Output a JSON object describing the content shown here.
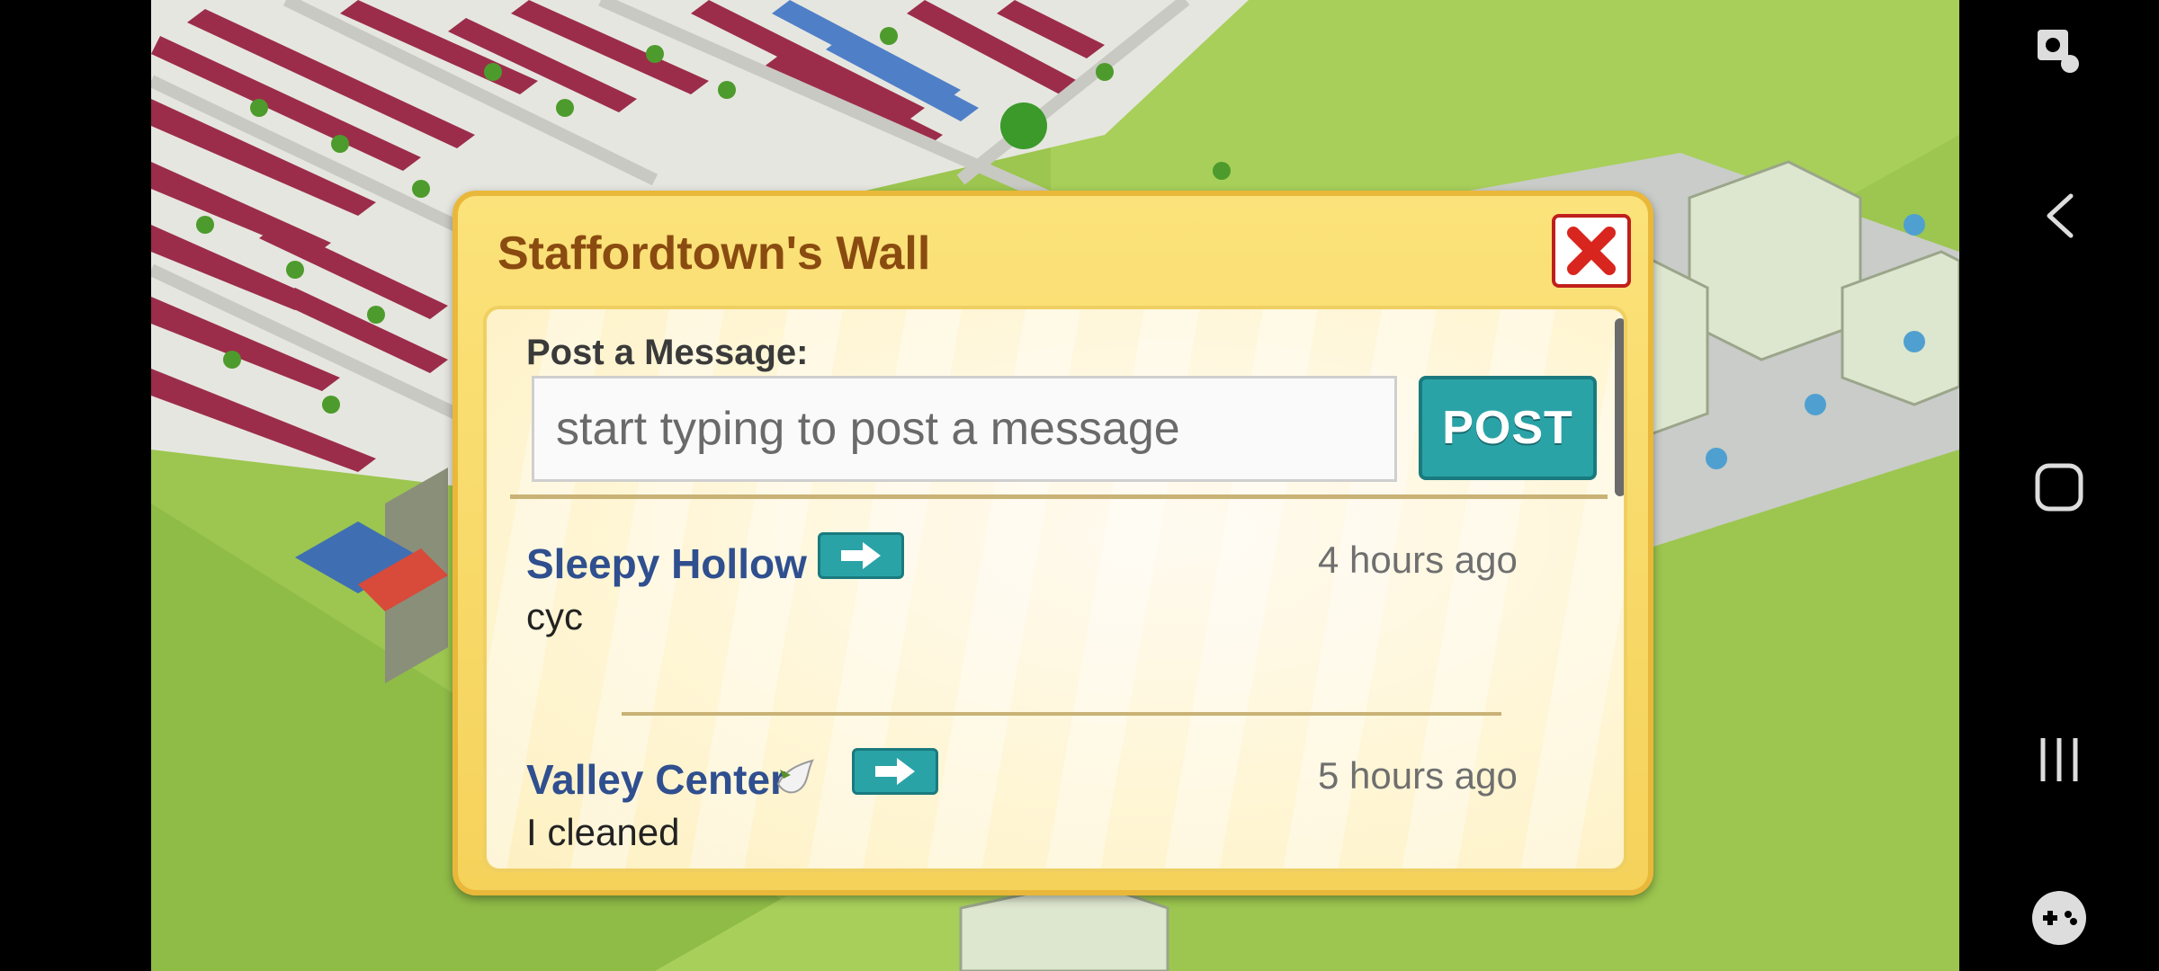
{
  "dialog": {
    "title": "Staffordtown's Wall",
    "post_label": "Post a Message:",
    "input_placeholder": "start typing to post a message",
    "input_value": "",
    "post_button": "POST"
  },
  "entries": [
    {
      "name": "Sleepy Hollow",
      "time": "4 hours ago",
      "message": "cyc"
    },
    {
      "name": "Valley Center",
      "time": "5 hours ago",
      "message": "I cleaned"
    }
  ],
  "icons": {
    "close": "close-x-icon",
    "go": "arrow-right-icon",
    "dove": "dove-icon",
    "nav": [
      "screen-touch-icon",
      "back-icon",
      "home-icon",
      "recents-icon",
      "game-controller-icon"
    ]
  },
  "colors": {
    "dialog_bg": "#f5d25a",
    "title": "#8a4b10",
    "name": "#2f4f8f",
    "post_button": "#2aa3a7",
    "close_border": "#c0201c"
  }
}
